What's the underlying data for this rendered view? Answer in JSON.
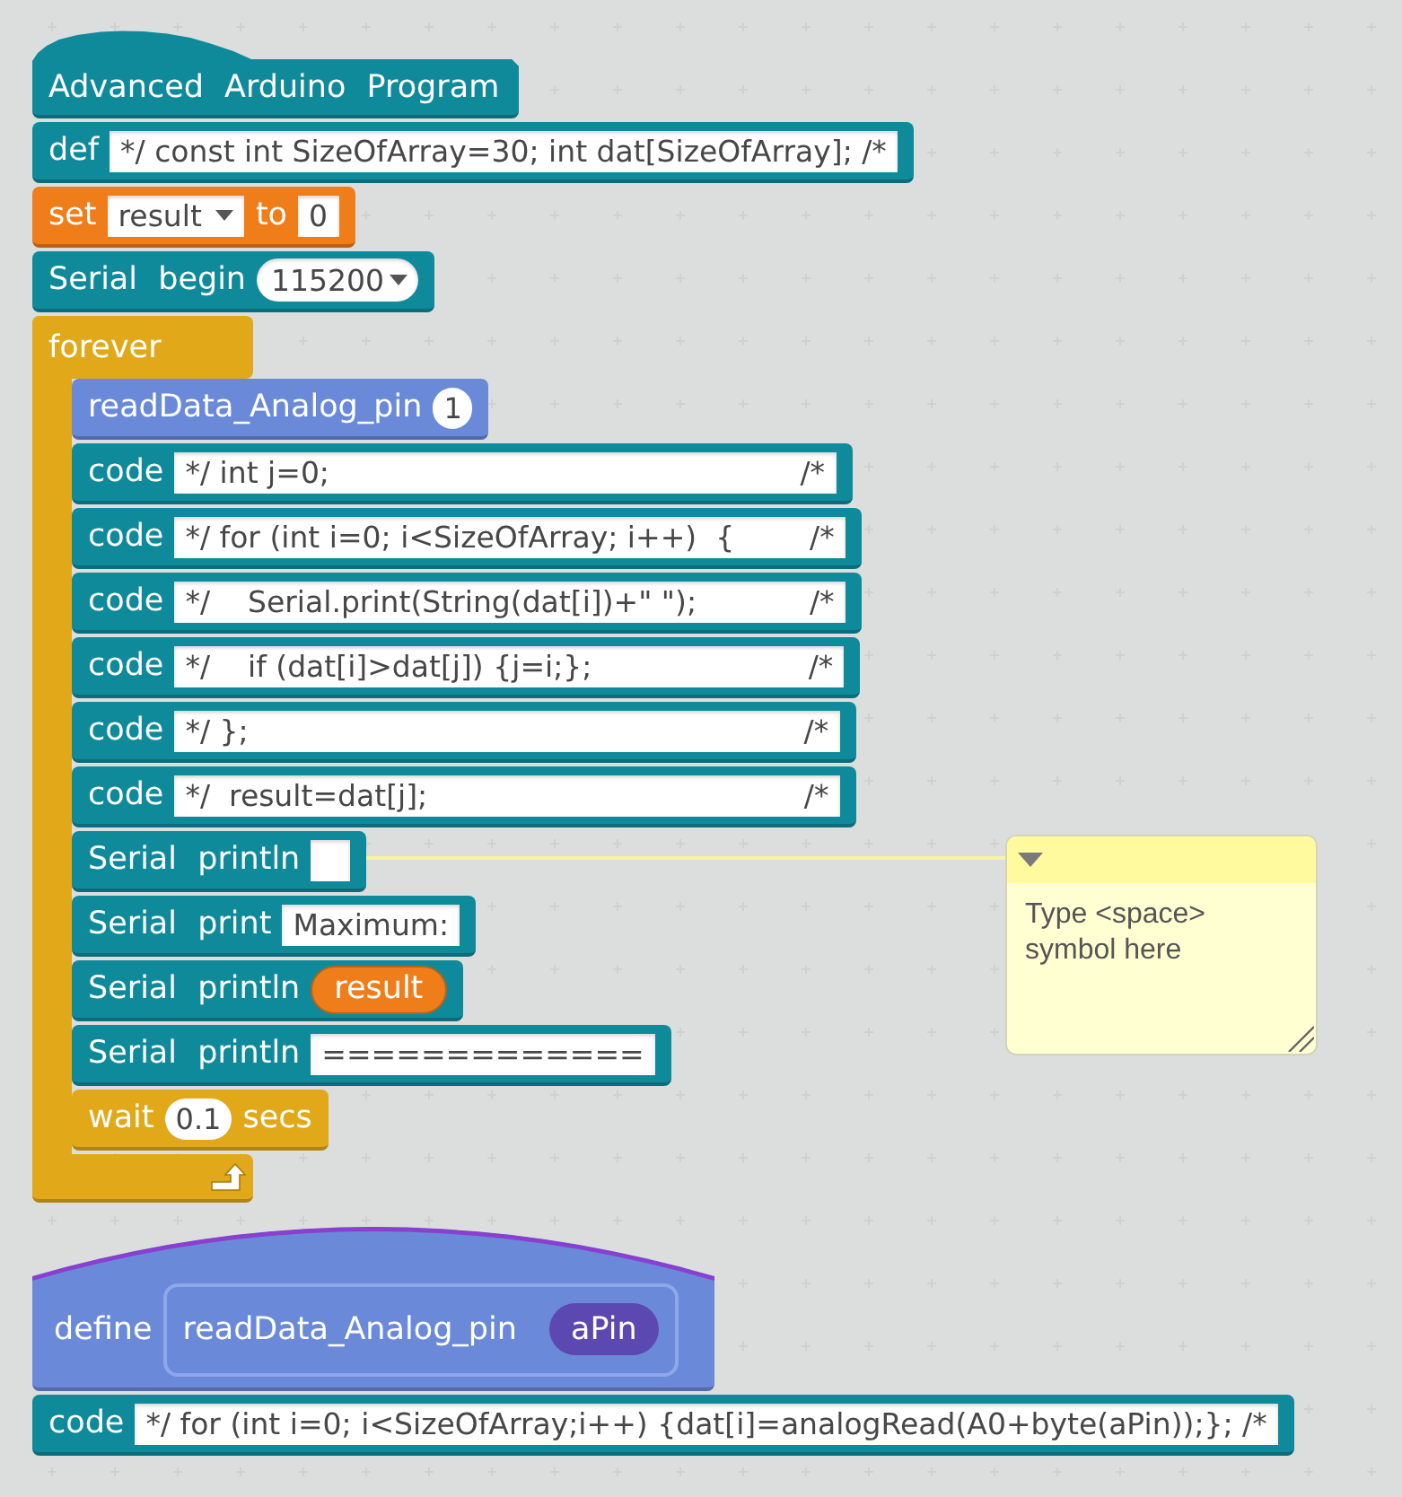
{
  "scripts": [
    {
      "blocks": [
        {
          "kind": "hat",
          "color": "#0f8a9b",
          "parts": [
            {
              "kind": "label",
              "text": "Advanced Arduino Program"
            }
          ]
        },
        {
          "kind": "stack",
          "color": "#0f8a9b",
          "parts": [
            {
              "kind": "label",
              "text": "def"
            },
            {
              "kind": "text",
              "value": "*/ const int SizeOfArray=30; int dat[SizeOfArray]; /*"
            }
          ]
        },
        {
          "kind": "stack",
          "color": "#ef7d1a",
          "parts": [
            {
              "kind": "label",
              "text": "set"
            },
            {
              "kind": "dropdown",
              "value": "result"
            },
            {
              "kind": "label",
              "text": "to"
            },
            {
              "kind": "text",
              "value": "0"
            }
          ]
        },
        {
          "kind": "stack",
          "color": "#0f8a9b",
          "parts": [
            {
              "kind": "label",
              "text": "Serial begin"
            },
            {
              "kind": "round-dropdown",
              "value": "115200"
            }
          ]
        },
        {
          "kind": "c",
          "color": "#e1a91a",
          "parts": [
            {
              "kind": "label",
              "text": "forever"
            }
          ],
          "children": [
            {
              "kind": "stack",
              "color": "#6a8ad9",
              "parts": [
                {
                  "kind": "label",
                  "text": "readData_Analog_pin"
                },
                {
                  "kind": "number",
                  "value": "1"
                }
              ]
            },
            {
              "kind": "stack",
              "color": "#0f8a9b",
              "parts": [
                {
                  "kind": "label",
                  "text": "code"
                },
                {
                  "kind": "text",
                  "value": "*/ int j=0;                                                  /*"
                }
              ]
            },
            {
              "kind": "stack",
              "color": "#0f8a9b",
              "parts": [
                {
                  "kind": "label",
                  "text": "code"
                },
                {
                  "kind": "text",
                  "value": "*/ for (int i=0; i<SizeOfArray; i++)  {        /*"
                }
              ]
            },
            {
              "kind": "stack",
              "color": "#0f8a9b",
              "parts": [
                {
                  "kind": "label",
                  "text": "code"
                },
                {
                  "kind": "text",
                  "value": "*/    Serial.print(String(dat[i])+\" \");            /*"
                }
              ]
            },
            {
              "kind": "stack",
              "color": "#0f8a9b",
              "parts": [
                {
                  "kind": "label",
                  "text": "code"
                },
                {
                  "kind": "text",
                  "value": "*/    if (dat[i]>dat[j]) {j=i;};                       /*"
                }
              ]
            },
            {
              "kind": "stack",
              "color": "#0f8a9b",
              "parts": [
                {
                  "kind": "label",
                  "text": "code"
                },
                {
                  "kind": "text",
                  "value": "*/ };                                                           /*"
                }
              ]
            },
            {
              "kind": "stack",
              "color": "#0f8a9b",
              "parts": [
                {
                  "kind": "label",
                  "text": "code"
                },
                {
                  "kind": "text",
                  "value": "*/  result=dat[j];                                        /*"
                }
              ]
            },
            {
              "kind": "stack",
              "color": "#0f8a9b",
              "parts": [
                {
                  "kind": "label",
                  "text": "Serial println"
                },
                {
                  "kind": "text"
                }
              ]
            },
            {
              "kind": "stack",
              "color": "#0f8a9b",
              "parts": [
                {
                  "kind": "label",
                  "text": "Serial print"
                },
                {
                  "kind": "text",
                  "value": "Maximum:"
                }
              ]
            },
            {
              "kind": "stack",
              "color": "#0f8a9b",
              "parts": [
                {
                  "kind": "label",
                  "text": "Serial println"
                },
                {
                  "kind": "reporter",
                  "color": "#ef7d1a",
                  "value": "result"
                }
              ]
            },
            {
              "kind": "stack",
              "color": "#0f8a9b",
              "parts": [
                {
                  "kind": "label",
                  "text": "Serial println"
                },
                {
                  "kind": "text",
                  "value": "============="
                }
              ]
            },
            {
              "kind": "stack",
              "color": "#e1a91a",
              "parts": [
                {
                  "kind": "label",
                  "text": "wait"
                },
                {
                  "kind": "number",
                  "value": "0.1"
                },
                {
                  "kind": "label",
                  "text": "secs"
                }
              ]
            }
          ]
        }
      ]
    },
    {
      "blocks": [
        {
          "kind": "define",
          "color": "#6a8ad9",
          "parts": [
            {
              "kind": "label",
              "text": "define"
            },
            {
              "kind": "prototype",
              "parts": [
                {
                  "kind": "label",
                  "text": "readData_Analog_pin"
                },
                {
                  "kind": "param",
                  "value": "aPin"
                }
              ]
            }
          ]
        },
        {
          "kind": "stack",
          "color": "#0f8a9b",
          "parts": [
            {
              "kind": "label",
              "text": "code"
            },
            {
              "kind": "text",
              "value": "*/ for (int i=0; i<SizeOfArray;i++) {dat[i]=analogRead(A0+byte(aPin));}; /*"
            }
          ]
        }
      ]
    }
  ],
  "comment": {
    "text": "Type <space> symbol here",
    "expanded": true
  }
}
